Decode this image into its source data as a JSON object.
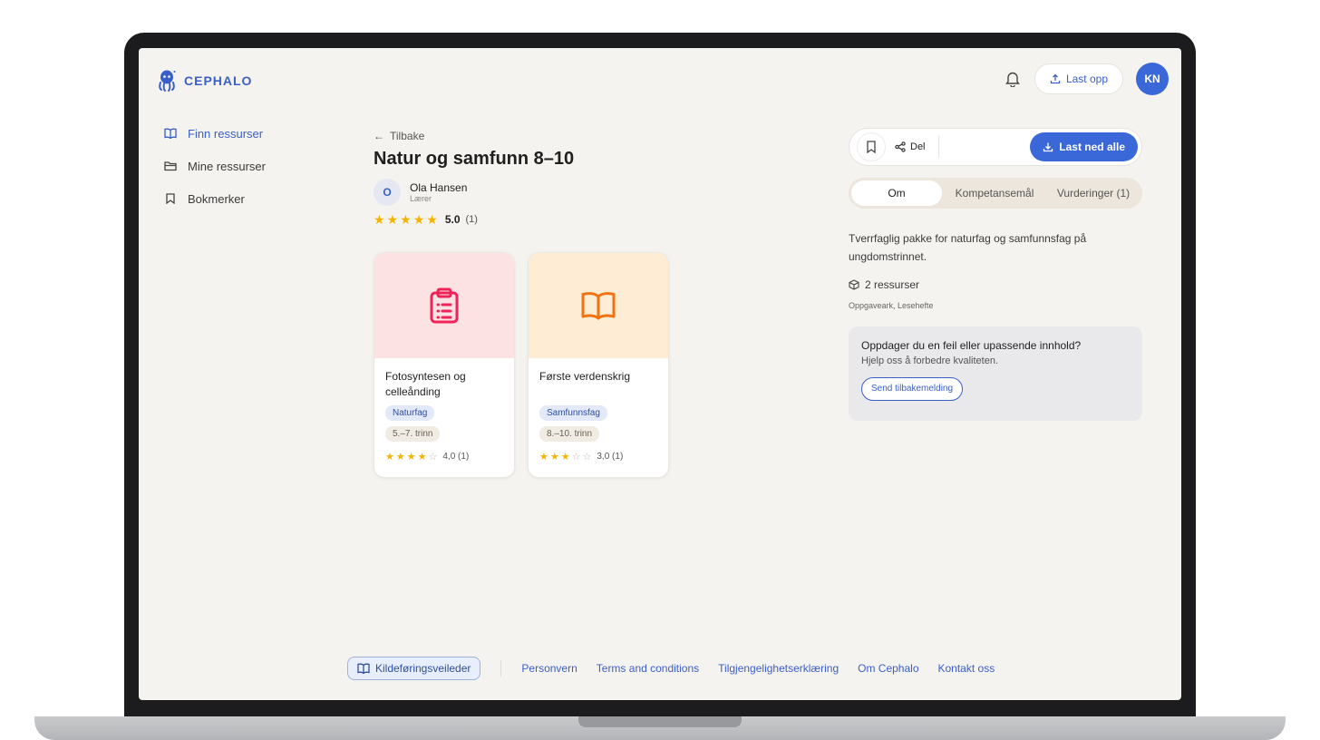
{
  "header": {
    "logo_text": "CEPHALO",
    "upload_label": "Last opp",
    "avatar_initials": "KN"
  },
  "sidebar": {
    "items": [
      {
        "label": "Finn ressurser",
        "icon": "book-open-icon",
        "active": true
      },
      {
        "label": "Mine ressurser",
        "icon": "folder-icon",
        "active": false
      },
      {
        "label": "Bokmerker",
        "icon": "bookmark-icon",
        "active": false
      }
    ]
  },
  "main": {
    "back_label": "Tilbake",
    "title": "Natur og samfunn 8–10",
    "author": {
      "initial": "O",
      "name": "Ola Hansen",
      "role": "Lærer"
    },
    "rating": {
      "value": "5.0",
      "count": "(1)",
      "stars": 5
    },
    "cards": [
      {
        "title": "Fotosyntesen og celleånding",
        "subject": "Naturfag",
        "level": "5.–7. trinn",
        "rating_text": "4,0 (1)",
        "stars": 4,
        "icon": "clipboard-list-icon",
        "color": "#fde2e4",
        "icon_color": "#f0225a"
      },
      {
        "title": "Første verdenskrig",
        "subject": "Samfunnsfag",
        "level": "8.–10. trinn",
        "rating_text": "3,0 (1)",
        "stars": 3,
        "icon": "book-open-icon",
        "color": "#feecd4",
        "icon_color": "#f07210"
      }
    ]
  },
  "panel": {
    "share_label": "Del",
    "download_all_label": "Last ned alle",
    "tabs": [
      {
        "label": "Om",
        "active": true
      },
      {
        "label": "Kompetansemål",
        "active": false
      },
      {
        "label": "Vurderinger (1)",
        "active": false
      }
    ],
    "description": "Tverrfaglig pakke for naturfag og samfunnsfag på ungdomstrinnet.",
    "resource_count": "2 ressurser",
    "resource_types": "Oppgaveark, Lesehefte",
    "feedback": {
      "title": "Oppdager du en feil eller upassende innhold?",
      "subtitle": "Hjelp oss å forbedre kvaliteten.",
      "button": "Send tilbakemelding"
    }
  },
  "footer": {
    "guide_label": "Kildeføringsveileder",
    "links": [
      "Personvern",
      "Terms and conditions",
      "Tilgjengelighetserklæring",
      "Om Cephalo",
      "Kontakt oss"
    ]
  },
  "colors": {
    "accent": "#3a68d8",
    "background": "#f5f3ef",
    "star": "#f5b301"
  }
}
